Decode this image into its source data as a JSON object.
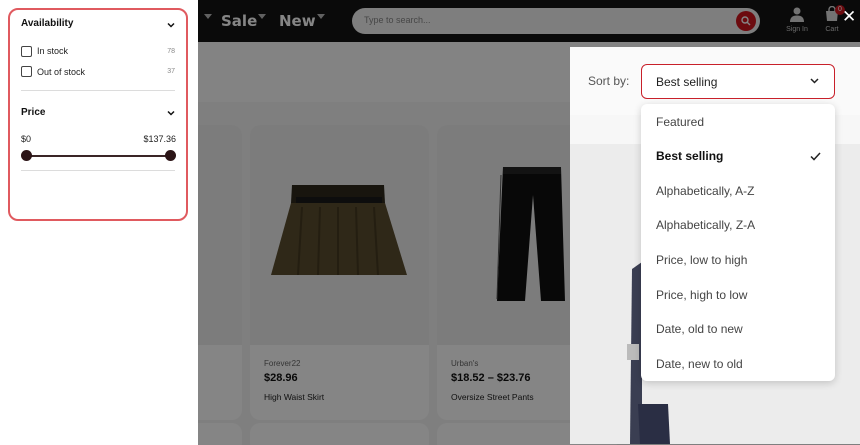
{
  "header": {
    "nav": [
      {
        "label": "Sale"
      },
      {
        "label": "New"
      }
    ],
    "search": {
      "placeholder": "Type to search..."
    },
    "sign_in_label": "Sign In",
    "cart_label": "Cart",
    "cart_count": "0"
  },
  "results_paren": ")",
  "products": [
    {
      "brand": "Forever22",
      "price": "$28.96",
      "title": "High Waist Skirt"
    },
    {
      "brand": "Urban's",
      "price": "$18.52 – $23.76",
      "title": "Oversize Street Pants"
    }
  ],
  "filters": {
    "availability": {
      "heading": "Availability",
      "options": [
        {
          "label": "In stock",
          "count": "78"
        },
        {
          "label": "Out of stock",
          "count": "37"
        }
      ]
    },
    "price": {
      "heading": "Price",
      "min": "$0",
      "max": "$137.36"
    }
  },
  "sort": {
    "label": "Sort by:",
    "selected": "Best selling",
    "options": [
      "Featured",
      "Best selling",
      "Alphabetically, A-Z",
      "Alphabetically, Z-A",
      "Price, low to high",
      "Price, high to low",
      "Date, old to new",
      "Date, new to old"
    ]
  },
  "close_label": "✕",
  "colors": {
    "accent": "#c8202a",
    "focus_outline": "#e05a5f",
    "header_bg": "#141414"
  }
}
